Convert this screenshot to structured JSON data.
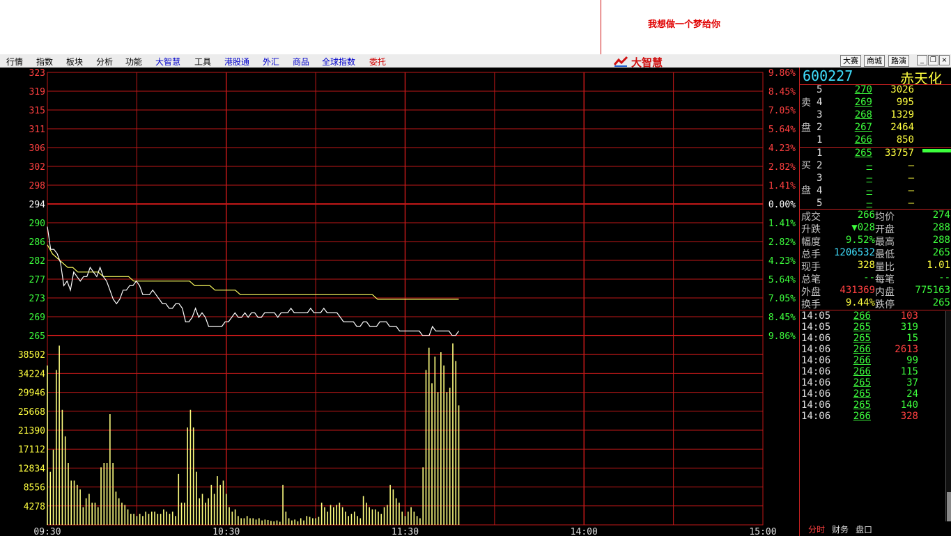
{
  "banner": {
    "text": "我想做一个梦给你"
  },
  "menu": [
    {
      "label": "行情",
      "color": "black"
    },
    {
      "label": "指数",
      "color": "black"
    },
    {
      "label": "板块",
      "color": "black"
    },
    {
      "label": "分析",
      "color": "black"
    },
    {
      "label": "功能",
      "color": "black"
    },
    {
      "label": "大智慧",
      "color": "blue"
    },
    {
      "label": "工具",
      "color": "black"
    },
    {
      "label": "港股通",
      "color": "blue"
    },
    {
      "label": "外汇",
      "color": "blue"
    },
    {
      "label": "商品",
      "color": "blue"
    },
    {
      "label": "全球指数",
      "color": "blue"
    },
    {
      "label": "委托",
      "color": "red"
    }
  ],
  "logo": {
    "text": "大智慧"
  },
  "top_buttons": [
    "大赛",
    "商城",
    "路演"
  ],
  "window_buttons": [
    "_",
    "❐",
    "×"
  ],
  "chart_data": {
    "type": "line",
    "price_axis": {
      "ticks": [
        323,
        319,
        315,
        311,
        306,
        302,
        298,
        294,
        290,
        286,
        282,
        277,
        273,
        269,
        265
      ],
      "pct_labels": [
        "9.86%",
        "8.45%",
        "7.05%",
        "5.64%",
        "4.23%",
        "2.82%",
        "1.41%",
        "0.00%",
        "1.41%",
        "2.82%",
        "4.23%",
        "5.64%",
        "7.05%",
        "8.45%",
        "9.86%"
      ],
      "prev_close": 294,
      "ylim": [
        265,
        323
      ]
    },
    "volume_axis": {
      "ticks": [
        38502,
        34224,
        29946,
        25668,
        21390,
        17112,
        12834,
        8556,
        4278
      ],
      "ylim": [
        0,
        42780
      ]
    },
    "x_ticks": [
      "09:30",
      "10:30",
      "11:30",
      "14:00",
      "15:00"
    ],
    "price_series": [
      289,
      284,
      284,
      283,
      281,
      276,
      277,
      275,
      279,
      278,
      277,
      278,
      278,
      280,
      279,
      278,
      280,
      278,
      277,
      275,
      273,
      272,
      273,
      275,
      275,
      276,
      276,
      277,
      276,
      274,
      274,
      274,
      275,
      274,
      273,
      272,
      272,
      271,
      271,
      272,
      272,
      271,
      268,
      268,
      269,
      271,
      269,
      270,
      269,
      267,
      267,
      267,
      267,
      267,
      268,
      268,
      269,
      270,
      269,
      269,
      270,
      269,
      270,
      270,
      269,
      269,
      270,
      270,
      270,
      270,
      269,
      270,
      270,
      270,
      271,
      270,
      270,
      270,
      270,
      270,
      271,
      270,
      270,
      270,
      271,
      270,
      270,
      270,
      270,
      269,
      268,
      268,
      268,
      268,
      267,
      267,
      268,
      268,
      267,
      267,
      267,
      268,
      268,
      268,
      267,
      267,
      267,
      266,
      266,
      266,
      266,
      266,
      266,
      266,
      265,
      265,
      265,
      267,
      266,
      266,
      266,
      266,
      266,
      265,
      265,
      266
    ],
    "avg_series": [
      285,
      283,
      282,
      281,
      280,
      280,
      279,
      279,
      279,
      279,
      279,
      278,
      278,
      278,
      278,
      278,
      278,
      277,
      277,
      277,
      277,
      277,
      277,
      277,
      277,
      277,
      277,
      277,
      277,
      276,
      276,
      276,
      276,
      275,
      275,
      275,
      275,
      275,
      274,
      274,
      274,
      274,
      274,
      274,
      274,
      274,
      274,
      274,
      274,
      274,
      274,
      274,
      274,
      274,
      274,
      274,
      274,
      274,
      274,
      274,
      274,
      274,
      274,
      274,
      274,
      273,
      273,
      273,
      273,
      273,
      273,
      273,
      273,
      273,
      273,
      273,
      273,
      273,
      273,
      273,
      273,
      273
    ],
    "volume_series": [
      36000,
      12000,
      17000,
      35000,
      40500,
      26000,
      20000,
      14000,
      10000,
      10000,
      9000,
      8000,
      4000,
      6000,
      7000,
      5000,
      5000,
      4000,
      13000,
      14000,
      14000,
      25000,
      14000,
      7500,
      6000,
      5000,
      4500,
      3500,
      2500,
      2500,
      2000,
      2500,
      2000,
      3000,
      2500,
      3000,
      3000,
      2500,
      2500,
      3500,
      3000,
      2500,
      3000,
      2000,
      11500,
      5000,
      5000,
      22000,
      26000,
      22000,
      12000,
      6000,
      7000,
      5000,
      6000,
      9000,
      7000,
      11000,
      9000,
      10000,
      7000,
      4000,
      3000,
      3500,
      2000,
      1500,
      1500,
      2000,
      1500,
      1500,
      1200,
      1500,
      1000,
      1200,
      1100,
      900,
      800,
      1000,
      700,
      9000,
      3000,
      1500,
      1000,
      1200,
      800,
      1500,
      1000,
      2000,
      1800,
      1500,
      1500,
      1800,
      5000,
      4000,
      3000,
      4500,
      4000,
      4500,
      5000,
      4000,
      3000,
      2000,
      2500,
      3000,
      2000,
      1500,
      6500,
      5000,
      4000,
      3500,
      3500,
      3000,
      2500,
      4000,
      4500,
      9000,
      8000,
      6000,
      5000,
      3000,
      2000,
      3000,
      4000,
      3000,
      2000,
      1500,
      13000,
      35000,
      40000,
      32000,
      38000,
      30000,
      39000,
      36000,
      30000,
      31000,
      41000,
      37000,
      27000
    ]
  },
  "stock": {
    "code": "600227",
    "name": "赤天化"
  },
  "order_book": {
    "sell_label_1": "卖",
    "sell_label_2": "盘",
    "buy_label_1": "买",
    "buy_label_2": "盘",
    "sells": [
      {
        "level": "5",
        "price": "270",
        "vol": "3026"
      },
      {
        "level": "4",
        "price": "269",
        "vol": "995"
      },
      {
        "level": "3",
        "price": "268",
        "vol": "1329"
      },
      {
        "level": "2",
        "price": "267",
        "vol": "2464"
      },
      {
        "level": "1",
        "price": "266",
        "vol": "850"
      }
    ],
    "buys": [
      {
        "level": "1",
        "price": "265",
        "vol": "33757"
      },
      {
        "level": "2",
        "price": "—",
        "vol": "—"
      },
      {
        "level": "3",
        "price": "—",
        "vol": "—"
      },
      {
        "level": "4",
        "price": "—",
        "vol": "—"
      },
      {
        "level": "5",
        "price": "—",
        "vol": "—"
      }
    ]
  },
  "quote": [
    {
      "l1": "成交",
      "v1": "266",
      "l2": "均价",
      "v2": "274"
    },
    {
      "l1": "升跌",
      "v1": "▼028",
      "l2": "开盘",
      "v2": "288"
    },
    {
      "l1": "幅度",
      "v1": "9.52%",
      "l2": "最高",
      "v2": "288"
    },
    {
      "l1": "总手",
      "v1": "1206532",
      "l2": "最低",
      "v2": "265"
    },
    {
      "l1": "现手",
      "v1": "328",
      "l2": "量比",
      "v2": "1.01"
    },
    {
      "l1": "总笔",
      "v1": "--",
      "l2": "每笔",
      "v2": "--"
    },
    {
      "l1": "外盘",
      "v1": "431369",
      "l2": "内盘",
      "v2": "775163"
    },
    {
      "l1": "换手",
      "v1": "9.44%",
      "l2": "跌停",
      "v2": "265"
    }
  ],
  "ticks": [
    {
      "time": "14:05",
      "price": "266",
      "vol": "103",
      "color": "red"
    },
    {
      "time": "14:05",
      "price": "265",
      "vol": "319",
      "color": "green"
    },
    {
      "time": "14:06",
      "price": "265",
      "vol": "15",
      "color": "green"
    },
    {
      "time": "14:06",
      "price": "266",
      "vol": "2613",
      "color": "red"
    },
    {
      "time": "14:06",
      "price": "266",
      "vol": "99",
      "color": "green"
    },
    {
      "time": "14:06",
      "price": "266",
      "vol": "115",
      "color": "green"
    },
    {
      "time": "14:06",
      "price": "265",
      "vol": "37",
      "color": "green"
    },
    {
      "time": "14:06",
      "price": "265",
      "vol": "24",
      "color": "green"
    },
    {
      "time": "14:06",
      "price": "265",
      "vol": "140",
      "color": "green"
    },
    {
      "time": "14:06",
      "price": "266",
      "vol": "328",
      "color": "red"
    }
  ],
  "tabs": [
    "分时",
    "财务",
    "盘口"
  ],
  "colors": {
    "grid": "#c01818",
    "price_line": "#ffffff",
    "avg_line": "#ffff60",
    "volume": "#ffff80",
    "up": "#ff4040",
    "down": "#3dff3d"
  }
}
